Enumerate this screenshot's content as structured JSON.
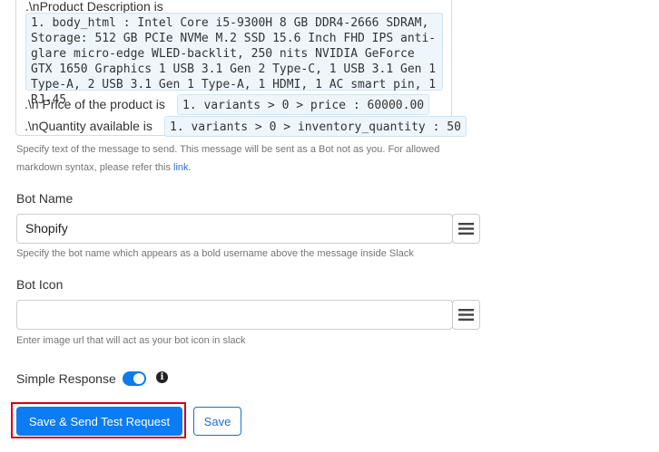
{
  "message": {
    "line1": ".\\nProduct Description is",
    "desc_chip": "1. body_html : Intel Core i5-9300H 8 GB DDR4-2666 SDRAM, Storage: 512 GB PCIe NVMe M.2 SSD 15.6 Inch FHD IPS anti-glare micro-edge WLED-backlit, 250 nits NVIDIA GeForce GTX 1650 Graphics 1 USB 3.1 Gen 2 Type-C, 1 USB 3.1 Gen 1 Type-A, 2 USB 3.1 Gen 1 Type-A, 1 HDMI, 1 AC smart pin, 1 RJ-45",
    "price_label": ".\\n Price of the product is",
    "price_chip": "1. variants > 0 > price : 60000.00",
    "qty_label": ".\\nQuantity available is",
    "qty_chip": "1. variants > 0 > inventory_quantity : 50",
    "help_part1": "Specify text of the message to send. This message will be sent as a Bot not as you. For allowed",
    "help_part2": "markdown syntax, please refer this",
    "help_link": "link.",
    "help_end": ""
  },
  "bot_name": {
    "label": "Bot Name",
    "value": "Shopify",
    "help": "Specify the bot name which appears as a bold username above the message inside Slack"
  },
  "bot_icon": {
    "label": "Bot Icon",
    "value": "",
    "help": "Enter image url that will act as your bot icon in slack"
  },
  "simple_response": {
    "label": "Simple Response",
    "enabled": true,
    "toggle_color": "#0a7cf0",
    "info_icon": "info-icon"
  },
  "actions": {
    "primary_label": "Save & Send Test Request",
    "secondary_label": "Save",
    "primary_color": "#0b7cf3",
    "highlight_color": "#d6000f"
  }
}
